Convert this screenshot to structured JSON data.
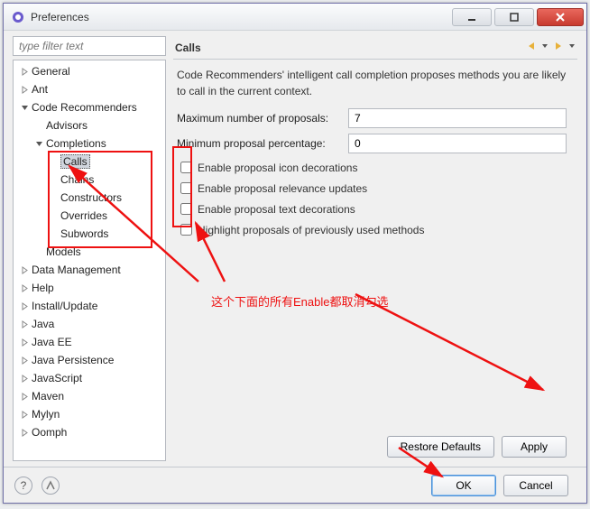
{
  "window": {
    "title": "Preferences"
  },
  "filter_placeholder": "type filter text",
  "tree": [
    {
      "indent": 0,
      "tri": "right",
      "label": "General"
    },
    {
      "indent": 0,
      "tri": "right",
      "label": "Ant"
    },
    {
      "indent": 0,
      "tri": "down",
      "label": "Code Recommenders"
    },
    {
      "indent": 1,
      "tri": "none",
      "label": "Advisors"
    },
    {
      "indent": 1,
      "tri": "down",
      "label": "Completions"
    },
    {
      "indent": 2,
      "tri": "none",
      "label": "Calls",
      "selected": true
    },
    {
      "indent": 2,
      "tri": "none",
      "label": "Chains"
    },
    {
      "indent": 2,
      "tri": "none",
      "label": "Constructors"
    },
    {
      "indent": 2,
      "tri": "none",
      "label": "Overrides"
    },
    {
      "indent": 2,
      "tri": "none",
      "label": "Subwords"
    },
    {
      "indent": 1,
      "tri": "none",
      "label": "Models"
    },
    {
      "indent": 0,
      "tri": "right",
      "label": "Data Management"
    },
    {
      "indent": 0,
      "tri": "right",
      "label": "Help"
    },
    {
      "indent": 0,
      "tri": "right",
      "label": "Install/Update"
    },
    {
      "indent": 0,
      "tri": "right",
      "label": "Java"
    },
    {
      "indent": 0,
      "tri": "right",
      "label": "Java EE"
    },
    {
      "indent": 0,
      "tri": "right",
      "label": "Java Persistence"
    },
    {
      "indent": 0,
      "tri": "right",
      "label": "JavaScript"
    },
    {
      "indent": 0,
      "tri": "right",
      "label": "Maven"
    },
    {
      "indent": 0,
      "tri": "right",
      "label": "Mylyn"
    },
    {
      "indent": 0,
      "tri": "right",
      "label": "Oomph"
    }
  ],
  "panel": {
    "title": "Calls",
    "description": "Code Recommenders' intelligent call completion proposes methods you are likely to call in the current context.",
    "maxProposalsLabel": "Maximum number of proposals:",
    "maxProposalsValue": "7",
    "minPercentageLabel": "Minimum proposal percentage:",
    "minPercentageValue": "0",
    "checks": [
      "Enable proposal icon decorations",
      "Enable proposal relevance updates",
      "Enable proposal text decorations",
      "Highlight proposals of previously used methods"
    ],
    "restore": "Restore Defaults",
    "apply": "Apply"
  },
  "footer": {
    "ok": "OK",
    "cancel": "Cancel"
  },
  "annotation": "这个下面的所有Enable都取消勾选"
}
